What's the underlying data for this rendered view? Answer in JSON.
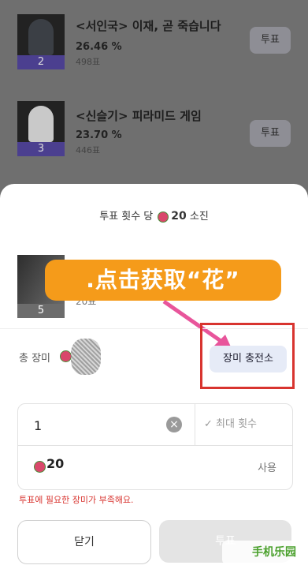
{
  "ranking": {
    "items": [
      {
        "title": "<서인국> 이재, 곧 죽습니다",
        "percent": "26.46",
        "percent_unit": "%",
        "votes": "498표",
        "rank": "2",
        "vote_label": "투표"
      },
      {
        "title": "<신슬기> 피라미드 게임",
        "percent": "23.70",
        "percent_unit": "%",
        "votes": "446표",
        "rank": "3",
        "vote_label": "투표"
      }
    ]
  },
  "sheet": {
    "header_prefix": "투표 횟수 당",
    "header_amount": "20",
    "header_suffix": "소진",
    "selected": {
      "rank": "5",
      "votes": "20표"
    },
    "banner_text": ".点击获取“花”",
    "rose_label": "총 장미",
    "charge_button": "장미 충전소",
    "quantity": "1",
    "max_button": "✓ 최대 횟수",
    "cost": "20",
    "use_label": "사용",
    "warning": "투표에 필요한 장미가 부족해요.",
    "close_button": "닫기",
    "vote_button": "투표",
    "watermark": "手机乐园"
  },
  "colors": {
    "accent_orange": "#f59b1a",
    "highlight_red": "#d8342f",
    "rank_purple": "#4b3f8f"
  }
}
